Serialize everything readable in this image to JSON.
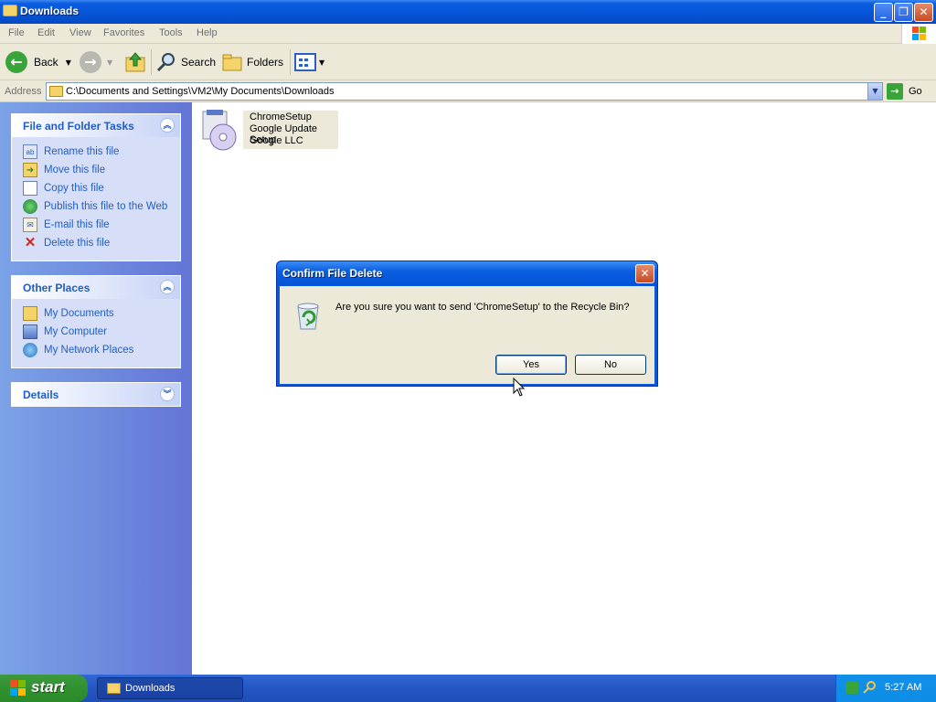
{
  "window": {
    "title": "Downloads"
  },
  "menu": [
    "File",
    "Edit",
    "View",
    "Favorites",
    "Tools",
    "Help"
  ],
  "toolbar": {
    "back": "Back",
    "search": "Search",
    "folders": "Folders"
  },
  "address": {
    "label": "Address",
    "path": "C:\\Documents and Settings\\VM2\\My Documents\\Downloads",
    "go": "Go"
  },
  "tasks": {
    "title": "File and Folder Tasks",
    "items": [
      "Rename this file",
      "Move this file",
      "Copy this file",
      "Publish this file to the Web",
      "E-mail this file",
      "Delete this file"
    ]
  },
  "places": {
    "title": "Other Places",
    "items": [
      "My Documents",
      "My Computer",
      "My Network Places"
    ]
  },
  "details": {
    "title": "Details"
  },
  "file": {
    "name": "ChromeSetup",
    "description": "Google Update Setup",
    "company": "Google LLC"
  },
  "dialog": {
    "title": "Confirm File Delete",
    "message": "Are you sure you want to send 'ChromeSetup' to the Recycle Bin?",
    "yes": "Yes",
    "no": "No"
  },
  "taskbar": {
    "start": "start",
    "task": "Downloads",
    "time": "5:27 AM"
  },
  "colors": {
    "titlebar": "#0553d6",
    "panel": "#6375d6",
    "taskbar": "#2456c2",
    "start": "#319131"
  }
}
